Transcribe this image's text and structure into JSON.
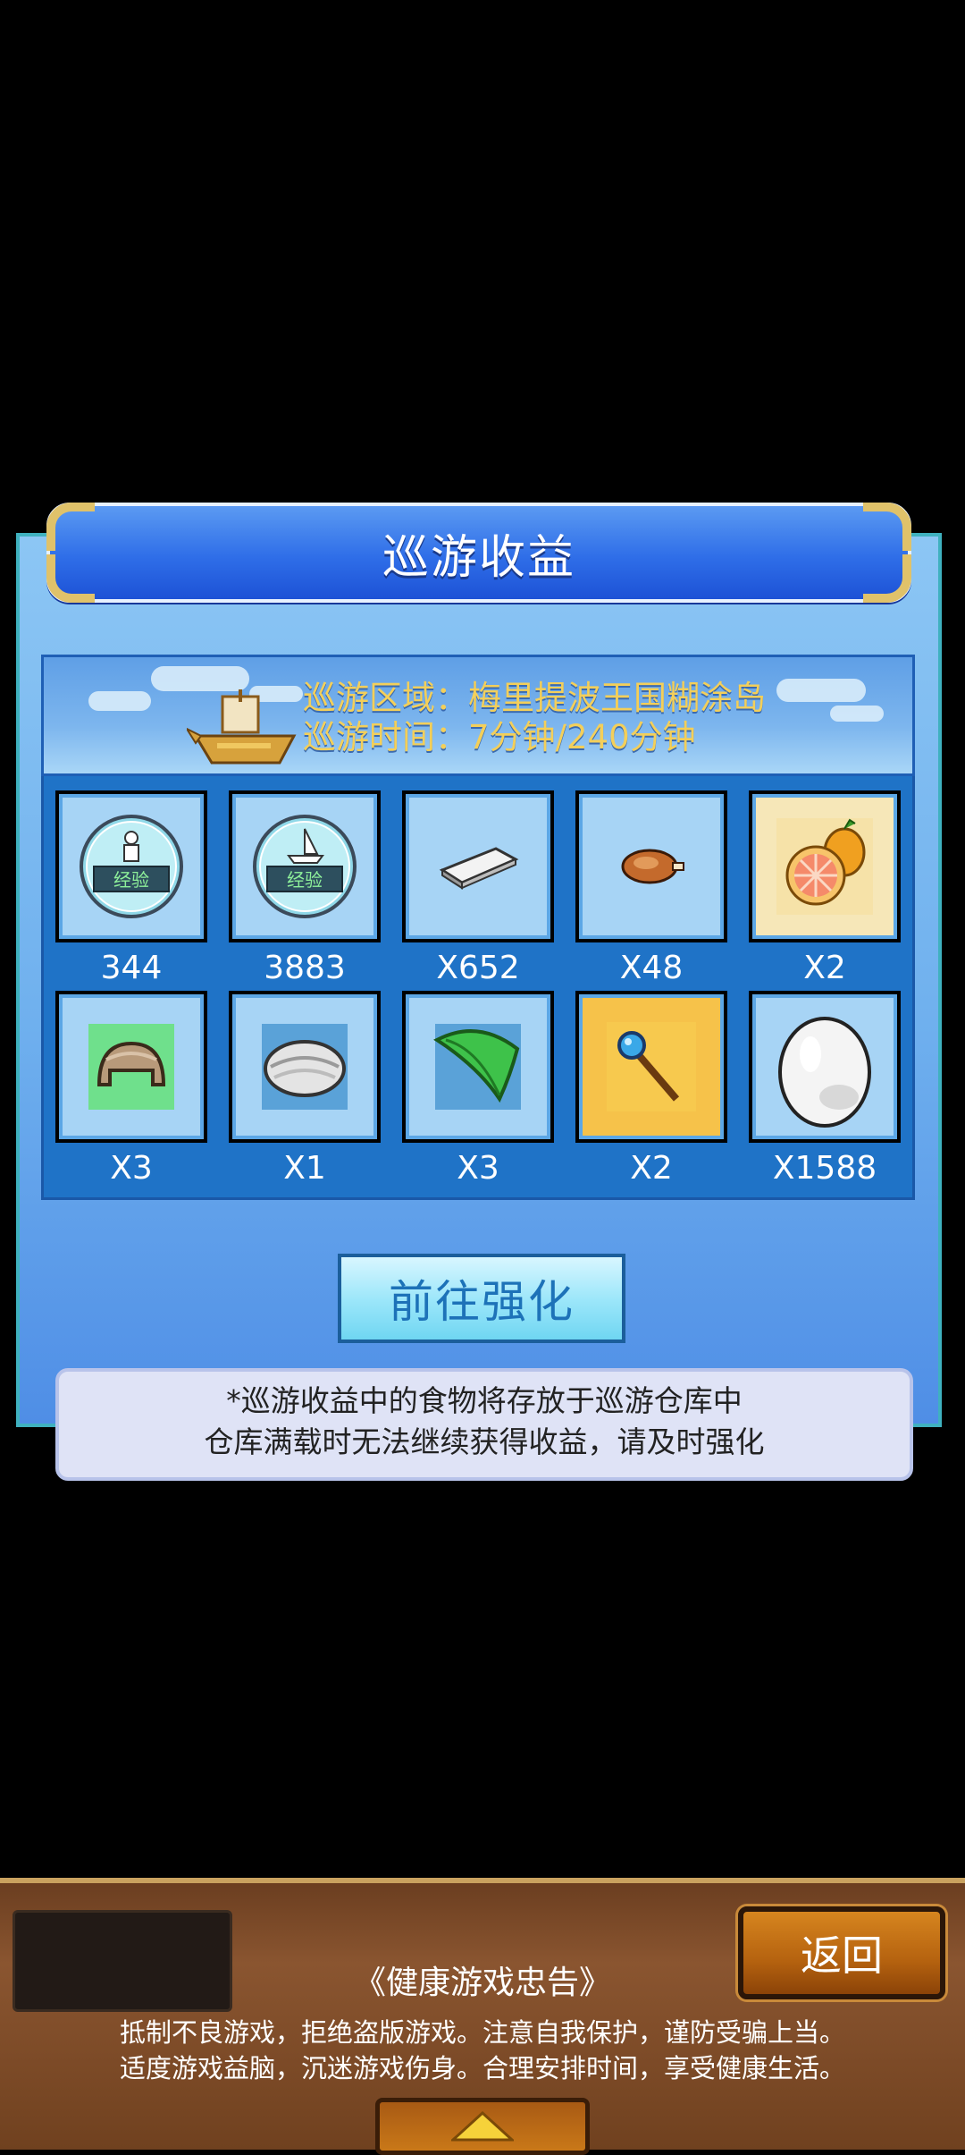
{
  "dialog": {
    "title": "巡游收益",
    "area_text": "巡游区域：梅里提波王国糊涂岛",
    "time_text": "巡游时间：7分钟/240分钟"
  },
  "rewards": [
    {
      "icon": "exp-person-icon",
      "qty": "344"
    },
    {
      "icon": "exp-ship-icon",
      "qty": "3883"
    },
    {
      "icon": "silver-bar-icon",
      "qty": "X652"
    },
    {
      "icon": "roast-meat-icon",
      "qty": "X48"
    },
    {
      "icon": "orange-fruit-icon",
      "qty": "X2"
    },
    {
      "icon": "bread-loaf-icon",
      "qty": "X3"
    },
    {
      "icon": "rice-bun-icon",
      "qty": "X1"
    },
    {
      "icon": "green-leaf-icon",
      "qty": "X3"
    },
    {
      "icon": "magic-staff-icon",
      "qty": "X2"
    },
    {
      "icon": "egg-icon",
      "qty": "X1588"
    }
  ],
  "exp_badge_text": "经验",
  "enhance_button": "前往强化",
  "notice": {
    "line1": "*巡游收益中的食物将存放于巡游仓库中",
    "line2": "仓库满载时无法继续获得收益，请及时强化"
  },
  "bottom_bar": {
    "back_button": "返回",
    "advice_title": "《健康游戏忠告》",
    "advice_line1": "抵制不良游戏，拒绝盗版游戏。注意自我保护，谨防受骗上当。",
    "advice_line2": "适度游戏益脑，沉迷游戏伤身。合理安排时间，享受健康生活。"
  },
  "colors": {
    "title_blue": "#2f6ee8",
    "info_gold": "#f3cf5a",
    "grid_blue": "#1f73c7",
    "enhance_text": "#1d72b8",
    "wood_brown": "#8a5530"
  }
}
